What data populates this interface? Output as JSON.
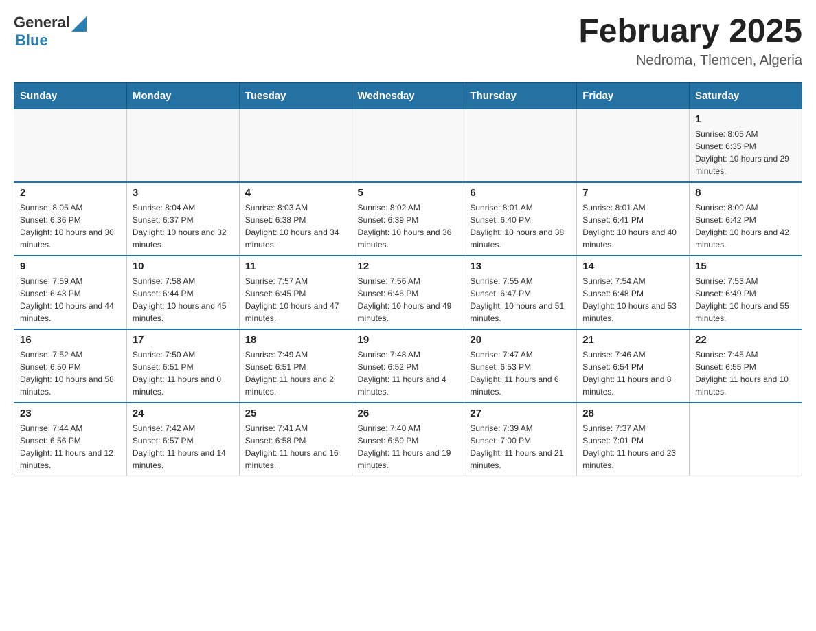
{
  "header": {
    "logo_general": "General",
    "logo_blue": "Blue",
    "title": "February 2025",
    "subtitle": "Nedroma, Tlemcen, Algeria"
  },
  "days_of_week": [
    "Sunday",
    "Monday",
    "Tuesday",
    "Wednesday",
    "Thursday",
    "Friday",
    "Saturday"
  ],
  "weeks": [
    [
      {
        "day": "",
        "detail": ""
      },
      {
        "day": "",
        "detail": ""
      },
      {
        "day": "",
        "detail": ""
      },
      {
        "day": "",
        "detail": ""
      },
      {
        "day": "",
        "detail": ""
      },
      {
        "day": "",
        "detail": ""
      },
      {
        "day": "1",
        "detail": "Sunrise: 8:05 AM\nSunset: 6:35 PM\nDaylight: 10 hours and 29 minutes."
      }
    ],
    [
      {
        "day": "2",
        "detail": "Sunrise: 8:05 AM\nSunset: 6:36 PM\nDaylight: 10 hours and 30 minutes."
      },
      {
        "day": "3",
        "detail": "Sunrise: 8:04 AM\nSunset: 6:37 PM\nDaylight: 10 hours and 32 minutes."
      },
      {
        "day": "4",
        "detail": "Sunrise: 8:03 AM\nSunset: 6:38 PM\nDaylight: 10 hours and 34 minutes."
      },
      {
        "day": "5",
        "detail": "Sunrise: 8:02 AM\nSunset: 6:39 PM\nDaylight: 10 hours and 36 minutes."
      },
      {
        "day": "6",
        "detail": "Sunrise: 8:01 AM\nSunset: 6:40 PM\nDaylight: 10 hours and 38 minutes."
      },
      {
        "day": "7",
        "detail": "Sunrise: 8:01 AM\nSunset: 6:41 PM\nDaylight: 10 hours and 40 minutes."
      },
      {
        "day": "8",
        "detail": "Sunrise: 8:00 AM\nSunset: 6:42 PM\nDaylight: 10 hours and 42 minutes."
      }
    ],
    [
      {
        "day": "9",
        "detail": "Sunrise: 7:59 AM\nSunset: 6:43 PM\nDaylight: 10 hours and 44 minutes."
      },
      {
        "day": "10",
        "detail": "Sunrise: 7:58 AM\nSunset: 6:44 PM\nDaylight: 10 hours and 45 minutes."
      },
      {
        "day": "11",
        "detail": "Sunrise: 7:57 AM\nSunset: 6:45 PM\nDaylight: 10 hours and 47 minutes."
      },
      {
        "day": "12",
        "detail": "Sunrise: 7:56 AM\nSunset: 6:46 PM\nDaylight: 10 hours and 49 minutes."
      },
      {
        "day": "13",
        "detail": "Sunrise: 7:55 AM\nSunset: 6:47 PM\nDaylight: 10 hours and 51 minutes."
      },
      {
        "day": "14",
        "detail": "Sunrise: 7:54 AM\nSunset: 6:48 PM\nDaylight: 10 hours and 53 minutes."
      },
      {
        "day": "15",
        "detail": "Sunrise: 7:53 AM\nSunset: 6:49 PM\nDaylight: 10 hours and 55 minutes."
      }
    ],
    [
      {
        "day": "16",
        "detail": "Sunrise: 7:52 AM\nSunset: 6:50 PM\nDaylight: 10 hours and 58 minutes."
      },
      {
        "day": "17",
        "detail": "Sunrise: 7:50 AM\nSunset: 6:51 PM\nDaylight: 11 hours and 0 minutes."
      },
      {
        "day": "18",
        "detail": "Sunrise: 7:49 AM\nSunset: 6:51 PM\nDaylight: 11 hours and 2 minutes."
      },
      {
        "day": "19",
        "detail": "Sunrise: 7:48 AM\nSunset: 6:52 PM\nDaylight: 11 hours and 4 minutes."
      },
      {
        "day": "20",
        "detail": "Sunrise: 7:47 AM\nSunset: 6:53 PM\nDaylight: 11 hours and 6 minutes."
      },
      {
        "day": "21",
        "detail": "Sunrise: 7:46 AM\nSunset: 6:54 PM\nDaylight: 11 hours and 8 minutes."
      },
      {
        "day": "22",
        "detail": "Sunrise: 7:45 AM\nSunset: 6:55 PM\nDaylight: 11 hours and 10 minutes."
      }
    ],
    [
      {
        "day": "23",
        "detail": "Sunrise: 7:44 AM\nSunset: 6:56 PM\nDaylight: 11 hours and 12 minutes."
      },
      {
        "day": "24",
        "detail": "Sunrise: 7:42 AM\nSunset: 6:57 PM\nDaylight: 11 hours and 14 minutes."
      },
      {
        "day": "25",
        "detail": "Sunrise: 7:41 AM\nSunset: 6:58 PM\nDaylight: 11 hours and 16 minutes."
      },
      {
        "day": "26",
        "detail": "Sunrise: 7:40 AM\nSunset: 6:59 PM\nDaylight: 11 hours and 19 minutes."
      },
      {
        "day": "27",
        "detail": "Sunrise: 7:39 AM\nSunset: 7:00 PM\nDaylight: 11 hours and 21 minutes."
      },
      {
        "day": "28",
        "detail": "Sunrise: 7:37 AM\nSunset: 7:01 PM\nDaylight: 11 hours and 23 minutes."
      },
      {
        "day": "",
        "detail": ""
      }
    ]
  ]
}
